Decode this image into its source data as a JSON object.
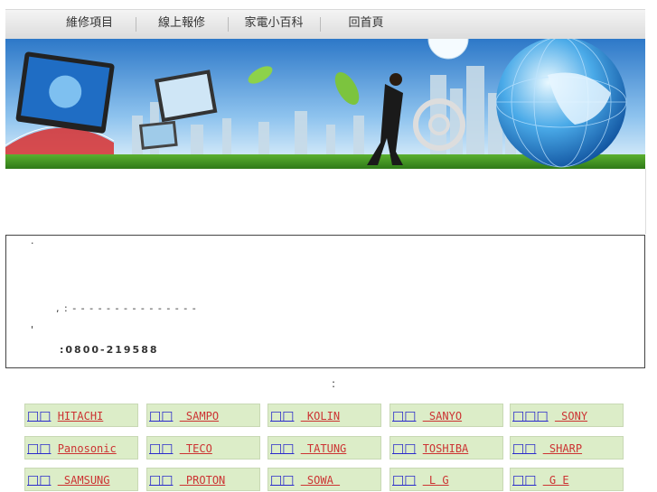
{
  "nav": {
    "items": [
      "維修項目",
      "線上報修",
      "家電小百科",
      "回首頁"
    ]
  },
  "info": {
    "line1": "·",
    "line2": ",  : - - - - - - - - - - - - - - -",
    "line3": "'",
    "phone": ":0800-219588"
  },
  "colon_text": ":",
  "brands": [
    {
      "glyph": "□□",
      "name": "HITACHI"
    },
    {
      "glyph": "□□",
      "name": " SAMPO"
    },
    {
      "glyph": "□□",
      "name": " KOLIN"
    },
    {
      "glyph": "□□",
      "name": " SANYO"
    },
    {
      "glyph": "□□□",
      "name": " SONY"
    },
    {
      "glyph": "□□",
      "name": "Panosonic"
    },
    {
      "glyph": "□□",
      "name": " TECO"
    },
    {
      "glyph": "□□",
      "name": " TATUNG"
    },
    {
      "glyph": "□□",
      "name": "TOSHIBA"
    },
    {
      "glyph": "□□",
      "name": " SHARP"
    },
    {
      "glyph": "□□",
      "name": " SAMSUNG"
    },
    {
      "glyph": "□□",
      "name": " PROTON"
    },
    {
      "glyph": "□□",
      "name": " SOWA "
    },
    {
      "glyph": "□□",
      "name": " L G"
    },
    {
      "glyph": "□□",
      "name": " G E"
    }
  ],
  "colors": {
    "brand_bg": "#dcedc8",
    "link_blue": "#2a2acb",
    "link_red": "#cc3333"
  }
}
